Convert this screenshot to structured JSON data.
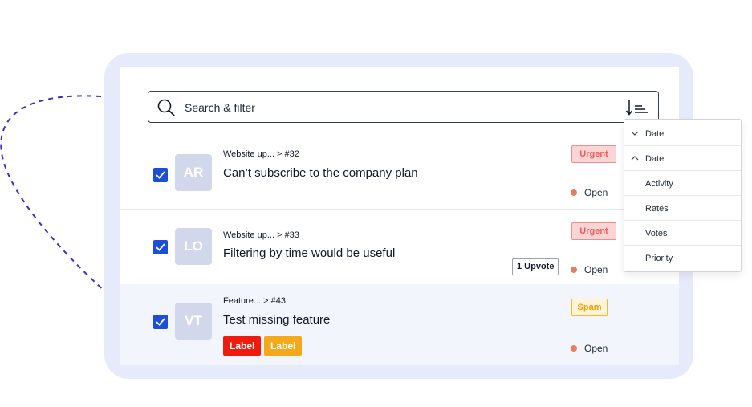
{
  "search": {
    "placeholder": "Search & filter",
    "icon": "search-icon",
    "sort_icon": "sort-descending-icon"
  },
  "items": [
    {
      "initials": "AR",
      "breadcrumb": "Website up... > #32",
      "title": "Can’t subscribe to the company plan",
      "tag": "Urgent",
      "status": "Open",
      "checked": true
    },
    {
      "initials": "LO",
      "breadcrumb": "Website up... > #33",
      "title": "Filtering by time would be useful",
      "tag": "Urgent",
      "upvote": "1 Upvote",
      "status": "Open",
      "checked": true
    },
    {
      "initials": "VT",
      "breadcrumb": "Feature... > #43",
      "title": "Test missing feature",
      "tag": "Spam",
      "labels": [
        "Label",
        "Label"
      ],
      "status": "Open",
      "checked": true
    }
  ],
  "sort_menu": {
    "options": [
      {
        "label": "Date",
        "icon": "chevron-down-icon"
      },
      {
        "label": "Date",
        "icon": "chevron-up-icon"
      },
      {
        "label": "Activity"
      },
      {
        "label": "Rates"
      },
      {
        "label": "Votes"
      },
      {
        "label": "Priority"
      }
    ]
  },
  "colors": {
    "accent": "#1d4ed8",
    "urgent": "#ef5b5b",
    "spam": "#f59e0b",
    "status_dot": "#e97c5e",
    "label_red": "#ef1b0e",
    "label_orange": "#f5a819"
  }
}
